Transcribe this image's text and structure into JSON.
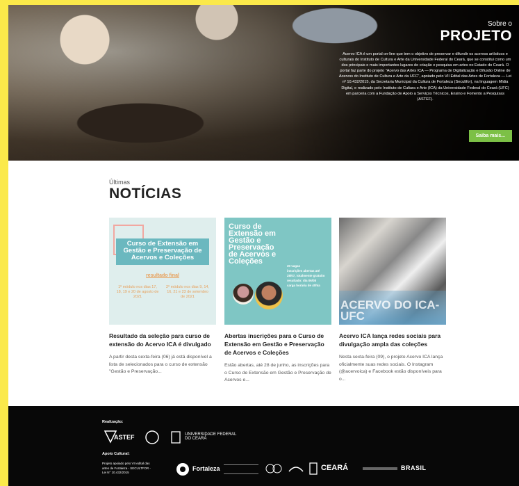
{
  "hero": {
    "subtitle": "Sobre o",
    "title": "PROJETO",
    "body": "Acervo ICA é um portal on-line que tem o objetivo de preservar e difundir os acervos artísticos e culturais do Instituto de Cultura e Arte da Universidade Federal do Ceará, que se constitui como um dos principais e mais importantes lugares de criação e pesquisa em artes no Estado do Ceará. O portal faz parte do projeto \"Acervo das Artes ICA — Programa de Digitalização e Difusão Online de Acervos do Instituto de Cultura e Arte da UFC\", apoiado pelo VII Edital das Artes de Fortaleza — Lei nº 10.432/2015, da Secretaria Municipal da Cultura de Fortaleza (Secultfor), na linguagem Mídia Digital, e realizado pelo Instituto de Cultura e Arte (ICA) da Universidade Federal do Ceará (UFC) em parceria com a Fundação de Apoio a Serviços Técnicos, Ensino e Fomento a Pesquisas (ASTEF).",
    "button": "Saiba mais..."
  },
  "news": {
    "subtitle": "Últimas",
    "title": "NOTÍCIAS",
    "cards": [
      {
        "title": "Resultado da seleção para curso de extensão do Acervo ICA é divulgado",
        "excerpt": "A partir desta sexta-feira (06) já está disponível a lista de selecionados para o curso de extensão \"Gestão e Preservação...",
        "thumb_banner": "Curso de Extensão em Gestão e Preservação de Acervos e Coleções",
        "thumb_result": "resultado final",
        "thumb_mod1": "1º módulo nos dias 17, 18, 19 e 20 de agosto de 2021",
        "thumb_mod2": "2º módulo nos dias 9, 14, 16, 21 e 23 de setembro de 2021"
      },
      {
        "title": "Abertas inscrições para o Curso de Extensão em Gestão e Preservação de Acervos e Coleções",
        "excerpt": "Estão abertas, até 28 de junho, as inscrições para o Curso de Extensão em Gestão e Preservação de Acervos e...",
        "thumb_big": "Curso de Extensão em Gestão e Preservação de Acervos e Coleções",
        "thumb_list": [
          "30 vagas",
          "inscrições abertas até 28/07, totalmente gratuito",
          "resultado: dia 06/08",
          "carga horária de 40h/a"
        ]
      },
      {
        "title": "Acervo ICA lança redes sociais para divulgação ampla das coleções",
        "excerpt": "Nesta sexta-feira (09), o projeto Acervo ICA lança oficialmente suas redes sociais. O Instagram (@acervoica) e Facebook estão disponíveis para o...",
        "thumb_wm": "ACERVO DO ICA-UFC"
      }
    ]
  },
  "footer": {
    "realizacao_label": "Realização:",
    "apoio_label": "Apoio Cultural:",
    "logos_realizacao": [
      "ASTEF",
      "UNIVERSIDADE FEDERAL DO CEARÁ"
    ],
    "logos_apoio": [
      "Fortaleza",
      "CEARÁ",
      "BRASIL"
    ],
    "apoio_note": "Projeto apoiado pelo VII edital das artes de Fortaleza - SECULTFOR - Lei N° 10.432/2015"
  },
  "colors": {
    "accent_green": "#7cc046",
    "border_yellow": "#fbe94a",
    "footer_bg": "#080808"
  }
}
